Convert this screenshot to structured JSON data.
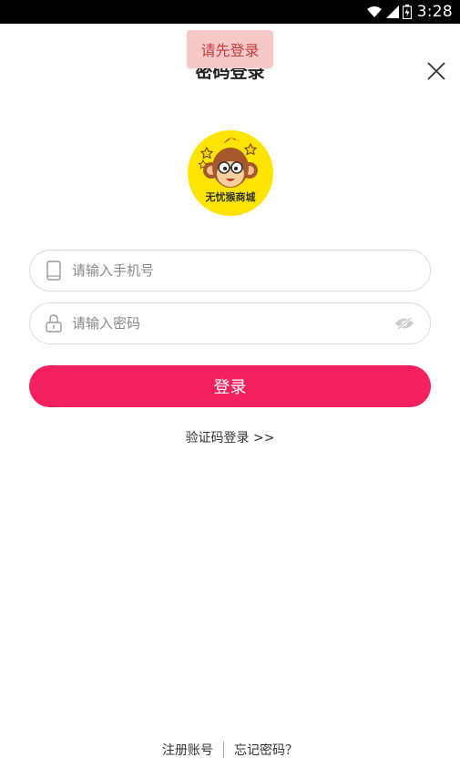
{
  "status_bar": {
    "time": "3:28"
  },
  "header": {
    "title": "密码登录"
  },
  "toast": {
    "text": "请先登录"
  },
  "logo": {
    "text": "无忧猴商城"
  },
  "form": {
    "phone_placeholder": "请输入手机号",
    "password_placeholder": "请输入密码",
    "login_label": "登录",
    "sms_login_link": "验证码登录 >>"
  },
  "footer": {
    "register_label": "注册账号",
    "forgot_label": "忘记密码？"
  },
  "colors": {
    "accent": "#f5215f",
    "toast_bg": "#f6c9c9",
    "toast_text": "#c23b3b",
    "logo_bg": "#ffe400"
  }
}
